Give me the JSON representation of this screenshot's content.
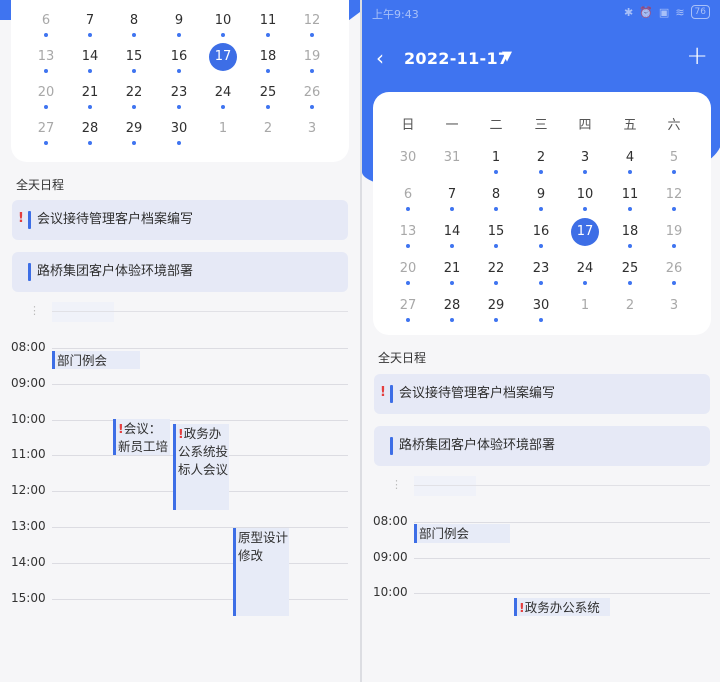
{
  "left": {
    "calendar": {
      "rows": [
        [
          {
            "n": "6",
            "dim": true,
            "dot": true
          },
          {
            "n": "7",
            "dot": true
          },
          {
            "n": "8",
            "dot": true
          },
          {
            "n": "9",
            "dot": true
          },
          {
            "n": "10",
            "dot": true
          },
          {
            "n": "11",
            "dot": true
          },
          {
            "n": "12",
            "dim": true,
            "dot": true
          }
        ],
        [
          {
            "n": "13",
            "dim": true,
            "dot": true
          },
          {
            "n": "14",
            "dot": true
          },
          {
            "n": "15",
            "dot": true
          },
          {
            "n": "16",
            "dot": true
          },
          {
            "n": "17",
            "sel": true,
            "dot": true
          },
          {
            "n": "18",
            "dot": true
          },
          {
            "n": "19",
            "dim": true,
            "dot": true
          }
        ],
        [
          {
            "n": "20",
            "dim": true,
            "dot": true
          },
          {
            "n": "21",
            "dot": true
          },
          {
            "n": "22",
            "dot": true
          },
          {
            "n": "23",
            "dot": true
          },
          {
            "n": "24",
            "dot": true
          },
          {
            "n": "25",
            "dot": true
          },
          {
            "n": "26",
            "dim": true,
            "dot": true
          }
        ],
        [
          {
            "n": "27",
            "dim": true,
            "dot": true
          },
          {
            "n": "28",
            "dot": true
          },
          {
            "n": "29",
            "dot": true
          },
          {
            "n": "30",
            "dot": true
          },
          {
            "n": "1",
            "dim": true
          },
          {
            "n": "2",
            "dim": true
          },
          {
            "n": "3",
            "dim": true
          }
        ]
      ]
    },
    "allday": {
      "label": "全天日程",
      "items": [
        {
          "title": "会议接待管理客户档案编写",
          "important": true
        },
        {
          "title": "路桥集团客户体验环境部署",
          "important": false
        }
      ]
    },
    "hours": [
      "08:00",
      "09:00",
      "10:00",
      "11:00",
      "12:00",
      "13:00",
      "14:00",
      "15:00"
    ],
    "events": [
      {
        "title": "部门例会",
        "important": false
      },
      {
        "title": "会议：新员工培",
        "important": true
      },
      {
        "title": "政务办公系统投标人会议",
        "important": true
      },
      {
        "title": "原型设计修改",
        "important": false
      }
    ]
  },
  "right": {
    "status": {
      "time": "上午9:43",
      "battery": "76"
    },
    "header": {
      "date": "2022-11-17",
      "back": "‹",
      "caret": "▼",
      "add": "+"
    },
    "calendar": {
      "weekdays": [
        "日",
        "一",
        "二",
        "三",
        "四",
        "五",
        "六"
      ],
      "rows": [
        [
          {
            "n": "30",
            "dim": true
          },
          {
            "n": "31",
            "dim": true
          },
          {
            "n": "1",
            "dot": true
          },
          {
            "n": "2",
            "dot": true
          },
          {
            "n": "3",
            "dot": true
          },
          {
            "n": "4",
            "dot": true
          },
          {
            "n": "5",
            "dim": true,
            "dot": true
          }
        ],
        [
          {
            "n": "6",
            "dim": true,
            "dot": true
          },
          {
            "n": "7",
            "dot": true
          },
          {
            "n": "8",
            "dot": true
          },
          {
            "n": "9",
            "dot": true
          },
          {
            "n": "10",
            "dot": true
          },
          {
            "n": "11",
            "dot": true
          },
          {
            "n": "12",
            "dim": true,
            "dot": true
          }
        ],
        [
          {
            "n": "13",
            "dim": true,
            "dot": true
          },
          {
            "n": "14",
            "dot": true
          },
          {
            "n": "15",
            "dot": true
          },
          {
            "n": "16",
            "dot": true
          },
          {
            "n": "17",
            "sel": true,
            "dot": true
          },
          {
            "n": "18",
            "dot": true
          },
          {
            "n": "19",
            "dim": true,
            "dot": true
          }
        ],
        [
          {
            "n": "20",
            "dim": true,
            "dot": true
          },
          {
            "n": "21",
            "dot": true
          },
          {
            "n": "22",
            "dot": true
          },
          {
            "n": "23",
            "dot": true
          },
          {
            "n": "24",
            "dot": true
          },
          {
            "n": "25",
            "dot": true
          },
          {
            "n": "26",
            "dim": true,
            "dot": true
          }
        ],
        [
          {
            "n": "27",
            "dim": true,
            "dot": true
          },
          {
            "n": "28",
            "dot": true
          },
          {
            "n": "29",
            "dot": true
          },
          {
            "n": "30",
            "dot": true
          },
          {
            "n": "1",
            "dim": true
          },
          {
            "n": "2",
            "dim": true
          },
          {
            "n": "3",
            "dim": true
          }
        ]
      ]
    },
    "allday": {
      "label": "全天日程",
      "items": [
        {
          "title": "会议接待管理客户档案编写",
          "important": true
        },
        {
          "title": "路桥集团客户体验环境部署",
          "important": false
        }
      ]
    },
    "hours": [
      "08:00",
      "09:00",
      "10:00"
    ],
    "events": [
      {
        "title": "部门例会",
        "important": false
      },
      {
        "title": "政务办公系统",
        "important": true
      }
    ]
  }
}
